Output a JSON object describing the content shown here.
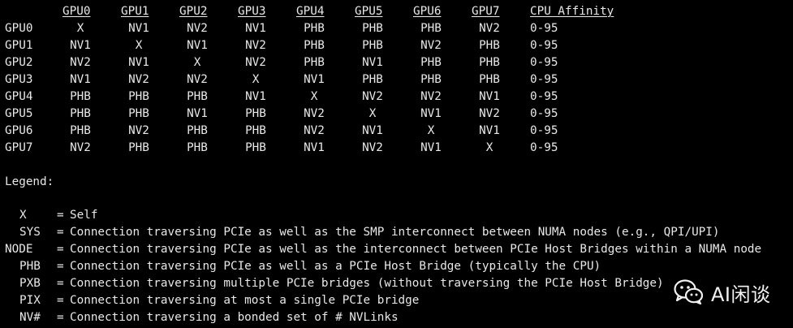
{
  "colors": {
    "background": "#000000",
    "foreground": "#e8e8e8",
    "prompt_green": "#3ee04c",
    "prompt_magenta": "#d94bd9",
    "prompt_cyan": "#3cc4d8"
  },
  "matrix": {
    "row_header": "",
    "columns": [
      "GPU0",
      "GPU1",
      "GPU2",
      "GPU3",
      "GPU4",
      "GPU5",
      "GPU6",
      "GPU7",
      "CPU Affinity"
    ],
    "rows": [
      {
        "label": "GPU0",
        "cells": [
          "X",
          "NV1",
          "NV2",
          "NV1",
          "PHB",
          "PHB",
          "PHB",
          "NV2",
          "0-95"
        ]
      },
      {
        "label": "GPU1",
        "cells": [
          "NV1",
          "X",
          "NV1",
          "NV2",
          "PHB",
          "PHB",
          "NV2",
          "PHB",
          "0-95"
        ]
      },
      {
        "label": "GPU2",
        "cells": [
          "NV2",
          "NV1",
          "X",
          "NV2",
          "PHB",
          "NV1",
          "PHB",
          "PHB",
          "0-95"
        ]
      },
      {
        "label": "GPU3",
        "cells": [
          "NV1",
          "NV2",
          "NV2",
          "X",
          "NV1",
          "PHB",
          "PHB",
          "PHB",
          "0-95"
        ]
      },
      {
        "label": "GPU4",
        "cells": [
          "PHB",
          "PHB",
          "PHB",
          "NV1",
          "X",
          "NV2",
          "NV2",
          "NV1",
          "0-95"
        ]
      },
      {
        "label": "GPU5",
        "cells": [
          "PHB",
          "PHB",
          "NV1",
          "PHB",
          "NV2",
          "X",
          "NV1",
          "NV2",
          "0-95"
        ]
      },
      {
        "label": "GPU6",
        "cells": [
          "PHB",
          "NV2",
          "PHB",
          "PHB",
          "NV2",
          "NV1",
          "X",
          "NV1",
          "0-95"
        ]
      },
      {
        "label": "GPU7",
        "cells": [
          "NV2",
          "PHB",
          "PHB",
          "PHB",
          "NV1",
          "NV2",
          "NV1",
          "X",
          "0-95"
        ]
      }
    ]
  },
  "legend": {
    "title": "Legend:",
    "items": [
      {
        "key": "X",
        "sep": "=",
        "desc": "Self"
      },
      {
        "key": "SYS",
        "sep": "=",
        "desc": "Connection traversing PCIe as well as the SMP interconnect between NUMA nodes (e.g., QPI/UPI)"
      },
      {
        "key": "NODE",
        "sep": "=",
        "desc": "Connection traversing PCIe as well as the interconnect between PCIe Host Bridges within a NUMA node"
      },
      {
        "key": "PHB",
        "sep": "=",
        "desc": "Connection traversing PCIe as well as a PCIe Host Bridge (typically the CPU)"
      },
      {
        "key": "PXB",
        "sep": "=",
        "desc": "Connection traversing multiple PCIe bridges (without traversing the PCIe Host Bridge)"
      },
      {
        "key": "PIX",
        "sep": "=",
        "desc": "Connection traversing at most a single PCIe bridge"
      },
      {
        "key": "NV#",
        "sep": "=",
        "desc": "Connection traversing a bonded set of # NVLinks"
      }
    ]
  },
  "watermark": {
    "icon": "wechat-icon",
    "text": "AI闲谈"
  }
}
